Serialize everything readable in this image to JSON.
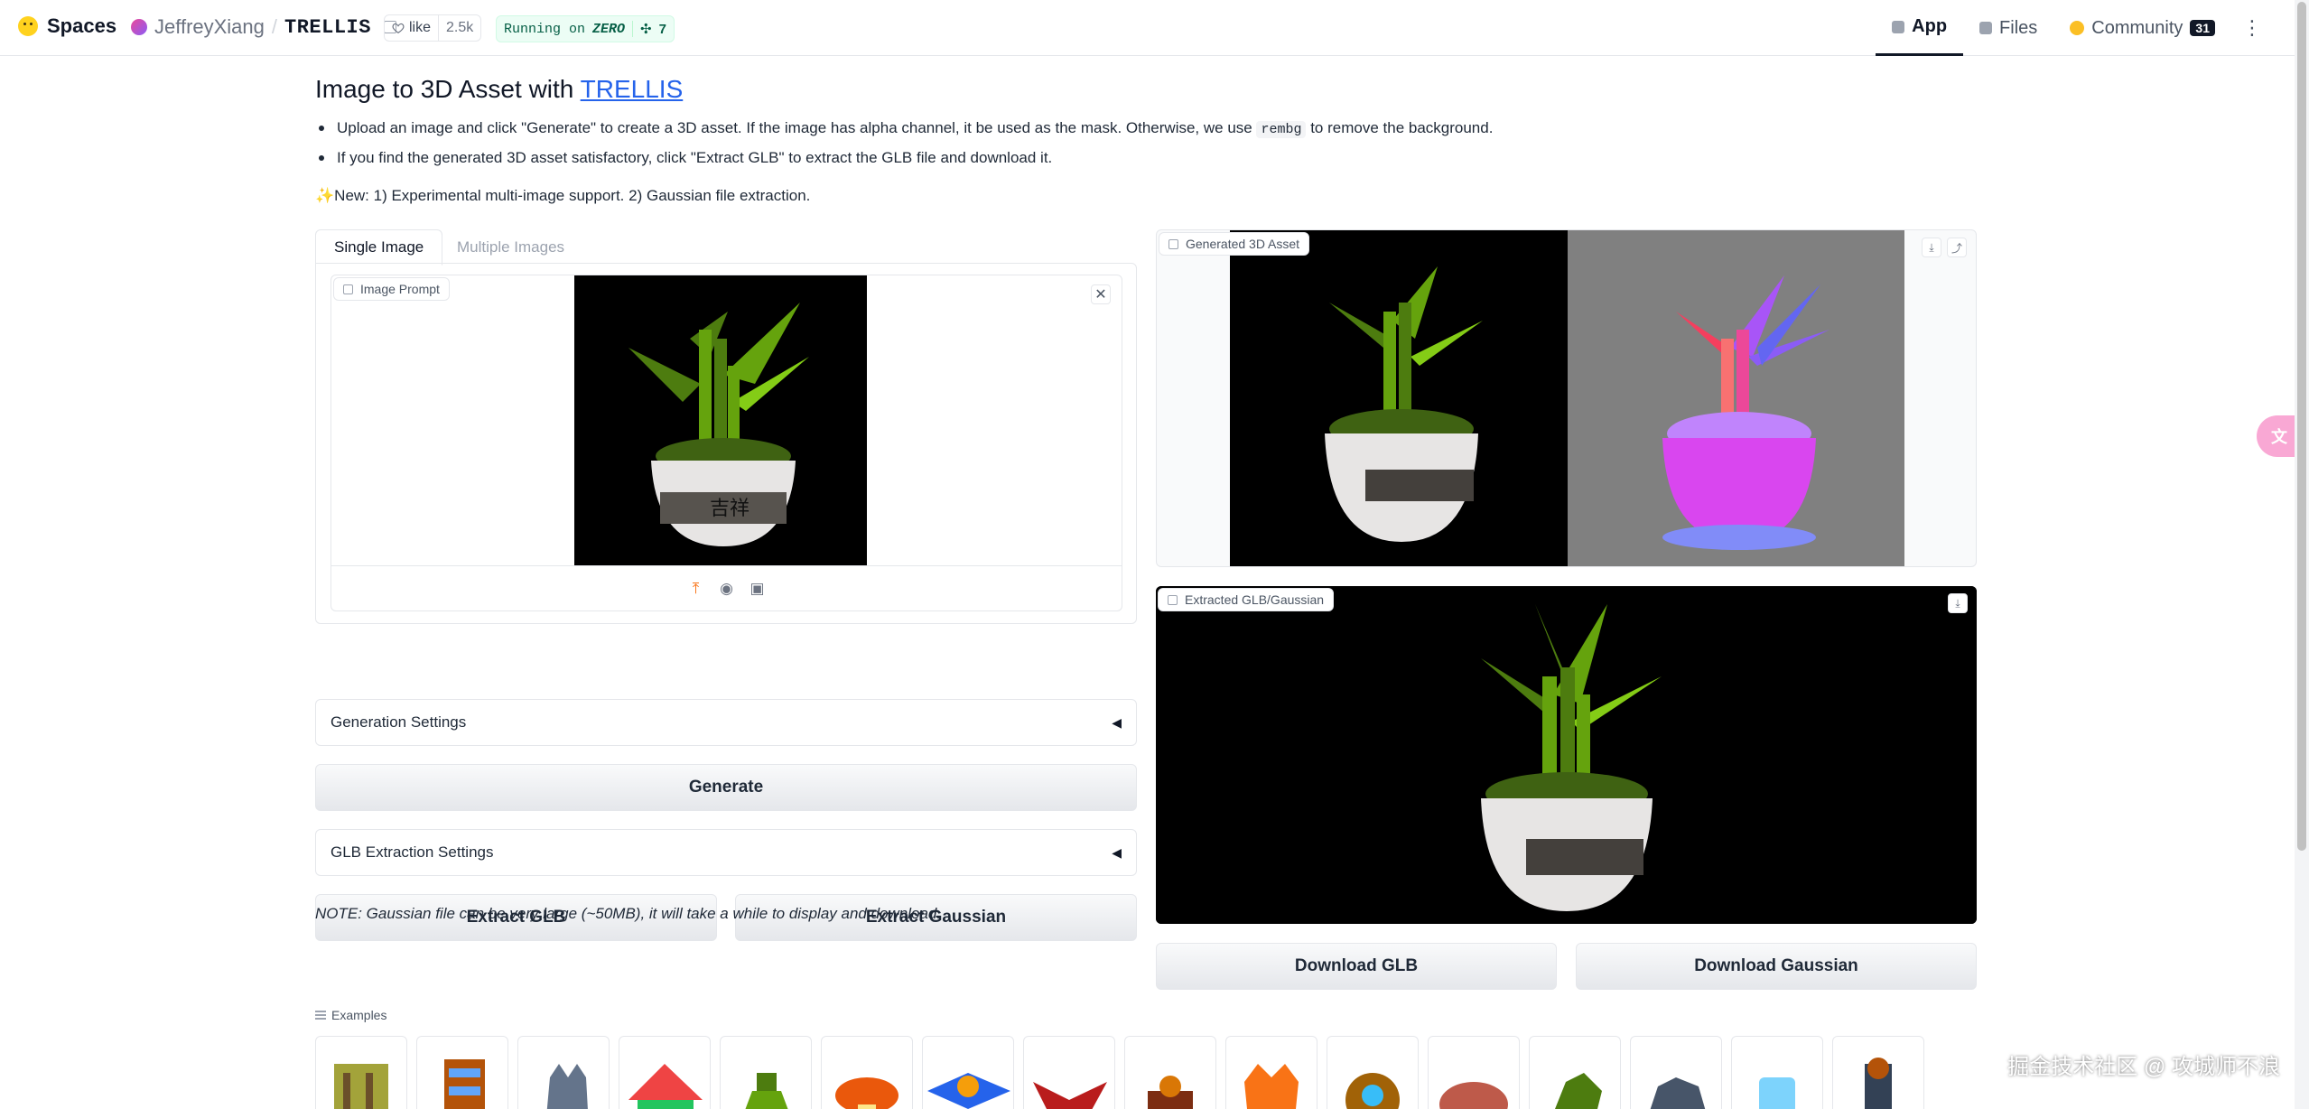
{
  "header": {
    "brand": "Spaces",
    "owner": "JeffreyXiang",
    "separator": "/",
    "repo": "TRELLIS",
    "like_label": "like",
    "like_count": "2.5k",
    "running_prefix": "Running on",
    "running_hw": "ZERO",
    "running_count": "7",
    "tabs": [
      {
        "label": "App",
        "active": true
      },
      {
        "label": "Files",
        "active": false
      },
      {
        "label": "Community",
        "badge": "31",
        "active": false
      }
    ]
  },
  "main": {
    "title_prefix": "Image to 3D Asset with ",
    "title_link": "TRELLIS",
    "bullets": [
      {
        "before": "Upload an image and click \"Generate\" to create a 3D asset. If the image has alpha channel, it be used as the mask. Otherwise, we use ",
        "code": "rembg",
        "after": " to remove the background."
      },
      {
        "text": "If you find the generated 3D asset satisfactory, click \"Extract GLB\" to extract the GLB file and download it."
      }
    ],
    "news_icon": "✨",
    "news": "New: 1) Experimental multi-image support. 2) Gaussian file extraction."
  },
  "left": {
    "tabs": [
      "Single Image",
      "Multiple Images"
    ],
    "image_prompt_label": "Image Prompt",
    "close": "✕",
    "generation_settings": "Generation Settings",
    "generate": "Generate",
    "glb_settings": "GLB Extraction Settings",
    "extract_glb": "Extract GLB",
    "extract_gaussian": "Extract Gaussian",
    "note": "NOTE: Gaussian file can be very large (~50MB), it will take a while to display and download.",
    "accordion_arrow": "◀"
  },
  "right": {
    "video_label": "Generated 3D Asset",
    "model_label": "Extracted GLB/Gaussian",
    "download_glb": "Download GLB",
    "download_gaussian": "Download Gaussian"
  },
  "examples": {
    "label": "Examples",
    "count": 16
  },
  "watermark": "掘金技术社区 @ 攻城师不浪",
  "colors": {
    "link": "#2563eb",
    "running_bg": "#ecfdf5",
    "upload_icon": "#f97316",
    "fab": "#f9a8d4"
  }
}
